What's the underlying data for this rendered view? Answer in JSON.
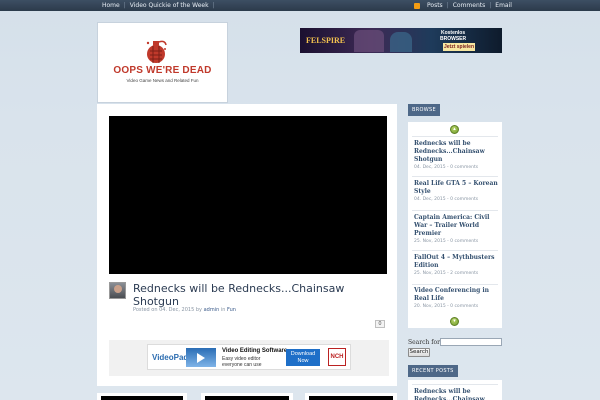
{
  "topbar": {
    "nav_left": [
      "Home",
      "Video Quickie of the Week"
    ],
    "nav_right": [
      "Posts",
      "Comments",
      "Email"
    ],
    "rss_icon_color": "#f39c12"
  },
  "header": {
    "logo_title": "OOPS WE'RE DEAD",
    "logo_subtitle": "Video Game News and Related Fun",
    "banner_ad": {
      "brand": "FELSPIRE",
      "label_line1": "Kostenlos",
      "label_line2": "BROWSER",
      "label_line3": "GAMES",
      "cta": "Jetzt spielen"
    }
  },
  "post": {
    "title": "Rednecks will be Rednecks...Chainsaw Shotgun",
    "meta_prefix": "Posted on",
    "date": "04. Dec, 2015",
    "by": "by",
    "author": "admin",
    "in": "in",
    "category": "Fun",
    "comment_count": "0"
  },
  "inner_ad": {
    "brand": "VideoPad",
    "title": "Video Editing Software",
    "subtitle": "Easy video editor everyone can use",
    "button": "Download Now",
    "publisher": "NCH"
  },
  "sidebar": {
    "browse_label": "BROWSE",
    "recent_label": "RECENT POSTS",
    "items": [
      {
        "title": "Rednecks will be Rednecks...Chainsaw Shotgun",
        "meta": "04. Dec, 2015 - 0 comments"
      },
      {
        "title": "Real Life GTA 5 – Korean Style",
        "meta": "04. Dec, 2015 - 0 comments"
      },
      {
        "title": "Captain America: Civil War – Trailer World Premier",
        "meta": "25. Nov, 2015 - 0 comments"
      },
      {
        "title": "FallOut 4 – Mythbusters Edition",
        "meta": "25. Nov, 2015 - 2 comments"
      },
      {
        "title": "Video Conferencing in Real Life",
        "meta": "20. Nov, 2015 - 0 comments"
      }
    ],
    "recent_first": "Rednecks will be Rednecks...Chainsaw",
    "search_label": "Search for:",
    "search_value": "",
    "search_button": "Search"
  }
}
